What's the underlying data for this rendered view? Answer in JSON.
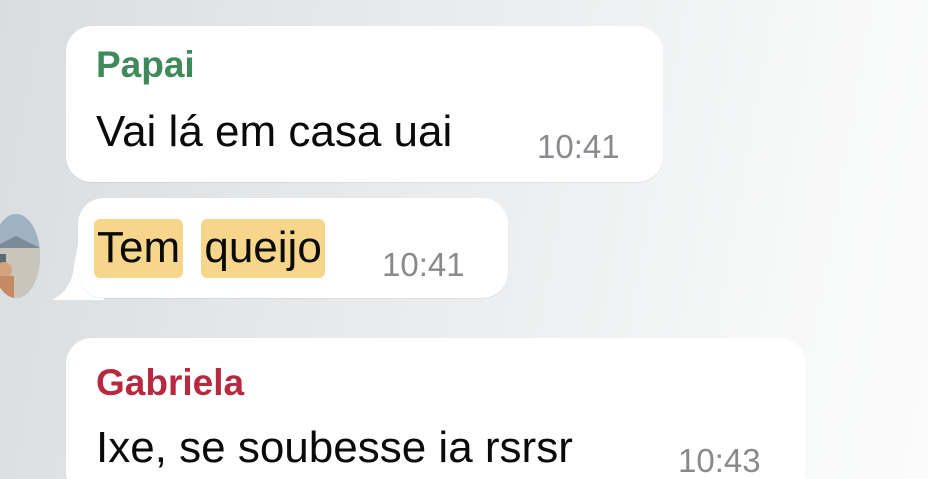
{
  "messages": [
    {
      "sender": "Papai",
      "sender_color": "#3f8a5a",
      "text": "Vai lá em casa uai",
      "time": "10:41"
    },
    {
      "words": [
        "Tem",
        "queijo"
      ],
      "highlight_color": "#f6d68a",
      "time": "10:41"
    },
    {
      "sender": "Gabriela",
      "sender_color": "#b8293f",
      "text": "Ixe, se soubesse ia rsrsr",
      "time": "10:43"
    }
  ]
}
